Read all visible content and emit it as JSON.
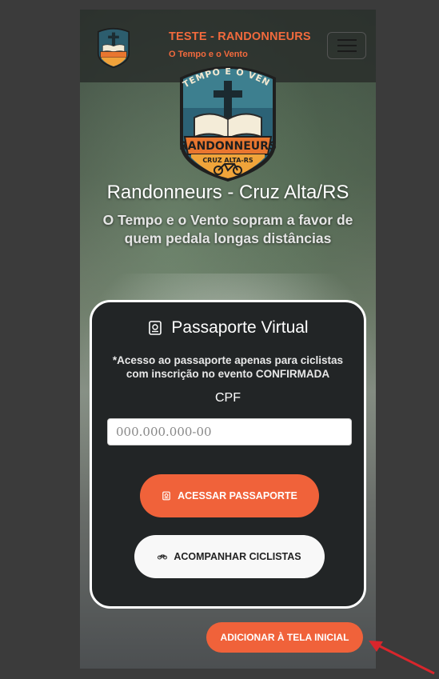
{
  "navbar": {
    "title": "TESTE - RANDONNEURS",
    "subtitle": "O Tempo e o Vento",
    "menu_icon": "hamburger-icon"
  },
  "logo": {
    "arc_text": "O TEMPO E O VENTO",
    "banner_text": "RANDONNEURS",
    "sub_text": "CRUZ ALTA-RS"
  },
  "hero": {
    "title": "Randonneurs - Cruz Alta/RS",
    "tagline": "O Tempo e o Vento sopram a favor de quem pedala longas distâncias"
  },
  "passport_card": {
    "title": "Passaporte Virtual",
    "title_icon": "passport-icon",
    "notice": "*Acesso ao passaporte apenas para ciclistas com inscrição no evento CONFIRMADA",
    "cpf_label": "CPF",
    "cpf_placeholder": "000.000.000-00",
    "cpf_value": "",
    "access_button": "ACESSAR PASSAPORTE",
    "access_icon": "passport-icon",
    "track_button": "ACOMPANHAR CICLISTAS",
    "track_icon": "bicycle-icon"
  },
  "install_button": "ADICIONAR À TELA INICIAL",
  "colors": {
    "accent": "#f0623a",
    "card_bg": "#222526",
    "annotation_arrow": "#d9262c"
  }
}
